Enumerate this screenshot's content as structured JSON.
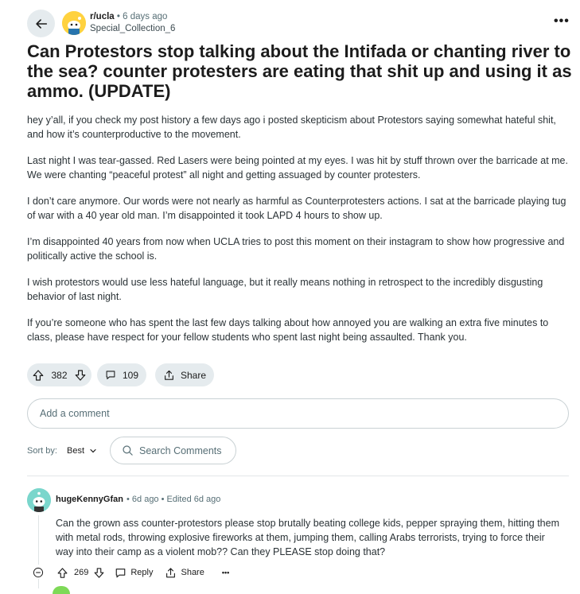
{
  "post": {
    "subreddit": "r/ucla",
    "age": "6 days ago",
    "author": "Special_Collection_6",
    "more": "•••",
    "title": "Can Protestors stop talking about the Intifada or chanting river to the sea? counter protesters are eating that shit up and using it as ammo. (UPDATE)",
    "paragraphs": [
      "hey y’all, if you check my post history a few days ago i posted skepticism about Protestors saying somewhat hateful shit, and how it’s counterproductive to the movement.",
      "Last night I was tear-gassed. Red Lasers were being pointed at my eyes. I was hit by stuff thrown over the barricade at me. We were chanting “peaceful protest” all night and getting assuaged by counter protesters.",
      "I don’t care anymore. Our words were not nearly as harmful as Counterprotesters actions. I sat at the barricade playing tug of war with a 40 year old man. I’m disappointed it took LAPD 4 hours to show up.",
      "I’m disappointed 40 years from now when UCLA tries to post this moment on their instagram to show how progressive and politically active the school is.",
      "I wish protestors would use less hateful language, but it really means nothing in retrospect to the incredibly disgusting behavior of last night.",
      "If you’re someone who has spent the last few days talking about how annoyed you are walking an extra five minutes to class, please have respect for your fellow students who spent last night being assaulted. Thank you."
    ],
    "votes": "382",
    "comments": "109",
    "share_label": "Share"
  },
  "comment_input": {
    "placeholder": "Add a comment"
  },
  "sort": {
    "label": "Sort by:",
    "value": "Best"
  },
  "search": {
    "placeholder": "Search Comments"
  },
  "comment": {
    "author": "hugeKennyGfan",
    "meta": "• 6d ago • Edited 6d ago",
    "body": "Can the grown ass counter-protestors please stop brutally beating college kids, pepper spraying them, hitting them with metal rods, throwing explosive fireworks at them, jumping them, calling Arabs terrorists, trying to force their way into their camp as a violent mob?? Can they PLEASE stop doing that?",
    "votes": "269",
    "reply_label": "Reply",
    "share_label": "Share",
    "more": "•••"
  },
  "icons": {
    "back": "arrow-left-icon",
    "subreddit": "subreddit-avatar-icon",
    "upvote": "upvote-icon",
    "downvote": "downvote-icon",
    "comment": "comment-bubble-icon",
    "share": "share-icon",
    "chevron": "chevron-down-icon",
    "search": "search-icon",
    "collapse": "collapse-thread-icon",
    "user_avatar": "user-avatar-icon"
  },
  "colors": {
    "pill_bg": "#e5ebee",
    "text_primary": "#1c1c1c",
    "text_secondary": "#576f76",
    "subreddit_avatar": "#ffd23f",
    "user_avatar": "#7ad6cc"
  }
}
